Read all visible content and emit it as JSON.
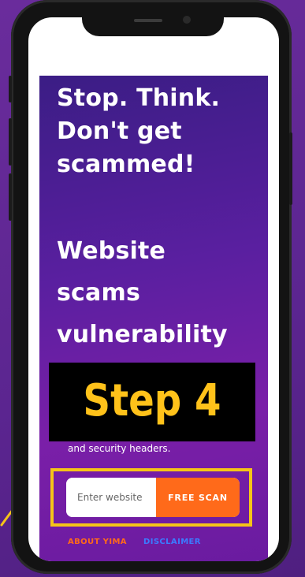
{
  "hero": {
    "headline_lines": [
      "Stop. Think.",
      "Don't get",
      "scammed!"
    ],
    "subheadline_lines": [
      "Website",
      "scams",
      "vulnerability"
    ],
    "step_label": "Step 4",
    "tagline": "and security headers."
  },
  "scan_form": {
    "input_value": "",
    "input_placeholder": "Enter website",
    "button_label": "FREE SCAN"
  },
  "footer": {
    "about_label": "ABOUT YIMA",
    "disclaimer_label": "DISCLAIMER"
  },
  "colors": {
    "background": "#5b2590",
    "hero_gradient_start": "#3b1d85",
    "hero_gradient_end": "#7a1fa8",
    "step_text": "#ffc21a",
    "highlight_border": "#f5c518",
    "scan_button": "#ff6a1a",
    "about_link": "#ff6a1a",
    "disclaimer_link": "#3b7bff"
  }
}
